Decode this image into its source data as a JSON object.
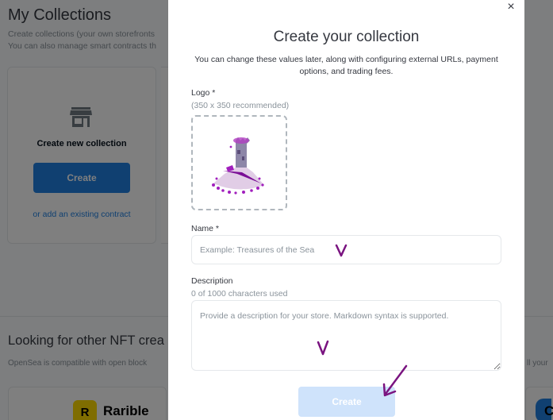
{
  "background": {
    "page_title": "My Collections",
    "subtitle_line1": "Create collections (your own storefronts",
    "subtitle_line2": "You can also manage smart contracts th",
    "card": {
      "title": "Create new collection",
      "button": "Create",
      "link": "or add an existing contract"
    },
    "section_title": "Looking for other NFT crea",
    "section_subtitle": "OpenSea is compatible with open block",
    "right_fragment": "ll your",
    "partner_rarible": "Rarible",
    "partner_rarible_mark": "R",
    "partner_right_text": "C"
  },
  "modal": {
    "close": "×",
    "title": "Create your collection",
    "description": "You can change these values later, along with configuring external URLs, payment options, and trading fees.",
    "logo_label": "Logo *",
    "logo_hint": "(350 x 350 recommended)",
    "name_label": "Name *",
    "name_placeholder": "Example: Treasures of the Sea",
    "name_value": "",
    "description_label": "Description",
    "description_counter": "0 of 1000 characters used",
    "description_placeholder": "Provide a description for your store. Markdown syntax is supported.",
    "description_value": "",
    "create_button": "Create"
  },
  "colors": {
    "accent": "#2081e2",
    "disabled_button": "#cfe3fb",
    "annotation": "#7a1480"
  }
}
